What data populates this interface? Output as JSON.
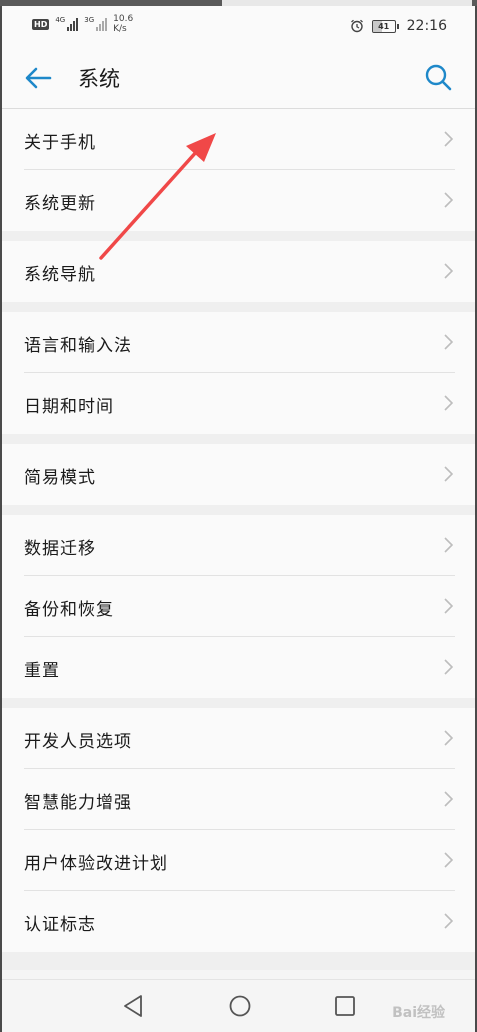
{
  "status_bar": {
    "hd_badge": "HD",
    "net_1": "4G",
    "net_2": "3G",
    "speed_value": "10.6",
    "speed_unit": "K/s",
    "battery_level": "41",
    "time": "22:16",
    "icons": [
      "alarm-clock-icon",
      "battery-icon",
      "signal-icon"
    ]
  },
  "app_bar": {
    "title": "系统",
    "back_icon": "back-arrow-icon",
    "search_icon": "search-icon"
  },
  "groups": [
    {
      "items": [
        {
          "label": "关于手机"
        },
        {
          "label": "系统更新"
        }
      ]
    },
    {
      "items": [
        {
          "label": "系统导航"
        }
      ]
    },
    {
      "items": [
        {
          "label": "语言和输入法"
        },
        {
          "label": "日期和时间"
        }
      ]
    },
    {
      "items": [
        {
          "label": "简易模式"
        }
      ]
    },
    {
      "items": [
        {
          "label": "数据迁移"
        },
        {
          "label": "备份和恢复"
        },
        {
          "label": "重置"
        }
      ]
    },
    {
      "items": [
        {
          "label": "开发人员选项"
        },
        {
          "label": "智慧能力增强"
        },
        {
          "label": "用户体验改进计划"
        },
        {
          "label": "认证标志"
        }
      ]
    }
  ],
  "colors": {
    "accent": "#1e88c9",
    "annotation_arrow": "#f04848"
  },
  "watermark": "Bai经验"
}
